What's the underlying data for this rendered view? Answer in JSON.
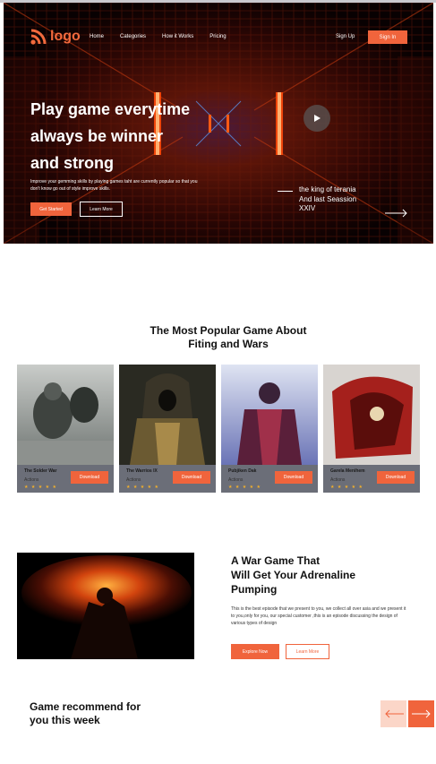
{
  "nav": {
    "logo_text": "logo",
    "links": [
      "Home",
      "Categories",
      "How it Works",
      "Pricing"
    ],
    "signup_label": "Sign Up",
    "signin_label": "Sign In"
  },
  "hero": {
    "title_line1": "Play game everytime",
    "title_line2": "always be winner",
    "title_line3": "and strong",
    "description": "Improve your gemming skills by playing games taht are currently popular so that you don't know go out of style improve skills.",
    "start_label": "Get Started",
    "learn_label": "Learn More",
    "episode_line1": "the king of terania",
    "episode_line2": "And last Seassion",
    "episode_line3": "XXIV"
  },
  "popular": {
    "title_line1": "The Most Popular Game About",
    "title_line2": "Fiting and Wars",
    "cards": [
      {
        "name": "The Solder War",
        "genre": "Actions",
        "stars": "★ ★ ★ ★ ★",
        "download_label": "Download"
      },
      {
        "name": "The Warrios IX",
        "genre": "Actions",
        "stars": "★ ★ ★ ★ ★",
        "download_label": "Download"
      },
      {
        "name": "Pubjiken Dak",
        "genre": "Actions",
        "stars": "★ ★ ★ ★ ★",
        "download_label": "Download"
      },
      {
        "name": "Garela Menihem",
        "genre": "Actions",
        "stars": "★ ★ ★ ★ ★",
        "download_label": "Download"
      }
    ]
  },
  "war": {
    "title_line1": "A War Game That",
    "title_line2": "Will Get Your Adrenaline",
    "title_line3": "Pumping",
    "description": "This is the best episode that we present to you, we collect all over asia and we present it to you,only for you, our special customer ,this is an episode discussing the design of various types of design",
    "explore_label": "Explore Now",
    "learn_label": "Learn More"
  },
  "recommend": {
    "title_line1": "Game recommend for",
    "title_line2": "you this week"
  },
  "colors": {
    "accent": "#f0643c",
    "accent_light": "#fbd6c8",
    "card_info_bg": "#6b6e78",
    "star": "#f2b02c"
  },
  "icons": [
    "rss-logo-icon",
    "play-icon",
    "arrow-right-icon",
    "arrow-left-icon"
  ]
}
